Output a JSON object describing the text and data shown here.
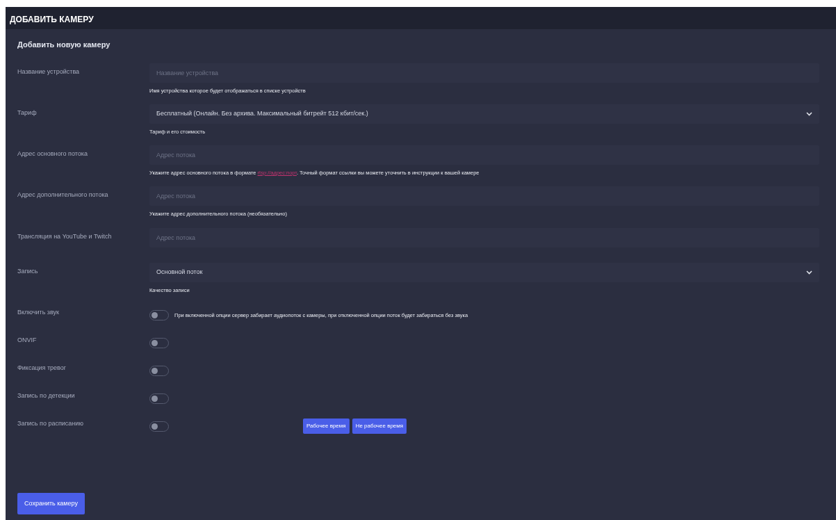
{
  "header": {
    "title": "ДОБАВИТЬ КАМЕРУ"
  },
  "form": {
    "title": "Добавить новую камеру",
    "rows": [
      {
        "kind": "input",
        "label": "Название устройства",
        "placeholder": "Название устройства",
        "help": "Имя устройства которое будет отображаться в списке устройств"
      },
      {
        "kind": "select",
        "label": "Тариф",
        "value": "Бесплатный (Онлайн. Без архива. Максимальный битрейт 512 кбит/сек.)",
        "help": "Тариф и его стоимость"
      },
      {
        "kind": "input",
        "label": "Адрес основного потока",
        "placeholder": "Адрес потока",
        "help": "Укажите адрес основного потока в формате",
        "help_link": "rtsp://адрес:порт",
        "help_after": ". Точный формат ссылки вы можете уточнить в инструкции к вашей камере"
      },
      {
        "kind": "input",
        "label": "Адрес дополнительного потока",
        "placeholder": "Адрес потока",
        "help": "Укажите адрес дополнительного потока (необязательно)"
      },
      {
        "kind": "input",
        "label": "Трансляция на YouTube и Twitch",
        "placeholder": "Адрес потока"
      },
      {
        "kind": "select",
        "label": "Запись",
        "value": "Основной поток",
        "help": "Качество записи"
      },
      {
        "kind": "toggle",
        "label": "Включить звук",
        "on": false,
        "note": "При включенной опции сервер забирает аудиопоток с камеры, при отключенной опции поток будет забираться без звука"
      },
      {
        "kind": "toggle",
        "label": "ONVIF",
        "on": false
      },
      {
        "kind": "toggle",
        "label": "Фиксация тревог",
        "on": false
      },
      {
        "kind": "toggle",
        "label": "Запись по детекции",
        "on": false
      },
      {
        "kind": "toggle",
        "label": "Запись по расписанию",
        "on": false,
        "buttons": [
          "Рабочее время",
          "Не рабочее время"
        ]
      }
    ],
    "submit": "Сохранить камеру"
  }
}
